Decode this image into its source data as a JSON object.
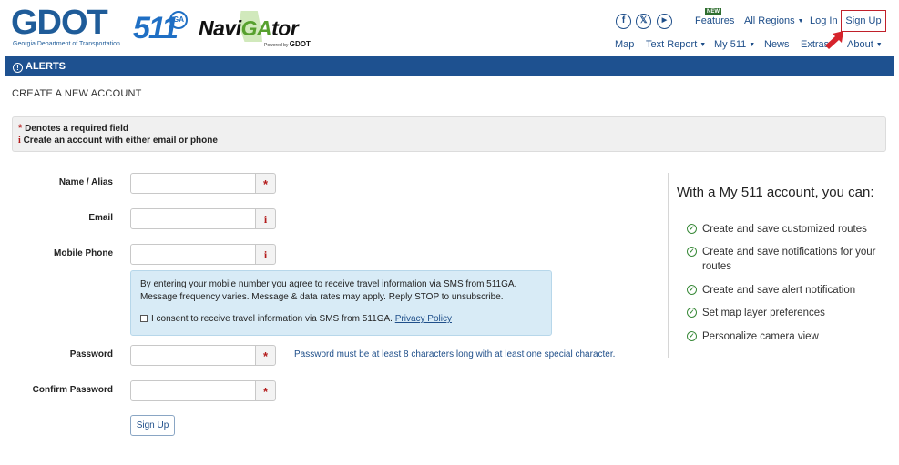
{
  "header": {
    "logo_gdot": "GDOT",
    "logo_gdot_sub": "Georgia Department of Transportation",
    "logo_511": "511",
    "logo_511_ga": "GA",
    "logo_navigator_pre": "Navi",
    "logo_navigator_ga": "GA",
    "logo_navigator_post": "tor",
    "logo_navigator_powered": "Powered by",
    "logo_navigator_gdot": "GDOT",
    "social": [
      "f",
      "𝕏",
      "▶"
    ],
    "new_badge": "NEW",
    "top_links": {
      "features": "Features",
      "regions": "All Regions",
      "login": "Log In",
      "signup": "Sign Up"
    },
    "nav": {
      "map": "Map",
      "text_report": "Text Report",
      "my511": "My 511",
      "news": "News",
      "extras": "Extras",
      "about": "About"
    }
  },
  "alerts_bar": {
    "icon": "!",
    "label": "ALERTS"
  },
  "page_title": "CREATE A NEW ACCOUNT",
  "notice": {
    "required_marker": "*",
    "required": "Denotes a required field",
    "info_marker": "i",
    "info": "Create an account with either email or phone"
  },
  "form": {
    "name_label": "Name / Alias",
    "email_label": "Email",
    "phone_label": "Mobile Phone",
    "password_label": "Password",
    "confirm_label": "Confirm Password",
    "required_marker": "*",
    "info_marker": "i",
    "sms_notice": "By entering your mobile number you agree to receive travel information via SMS from 511GA. Message frequency varies. Message & data rates may apply. Reply STOP to unsubscribe.",
    "sms_consent": "I consent to receive travel information via SMS from 511GA.",
    "privacy_link": "Privacy Policy",
    "password_hint": "Password must be at least 8 characters long with at least one special character.",
    "submit": "Sign Up"
  },
  "benefits": {
    "title": "With a My 511 account, you can:",
    "check_icon": "✓",
    "items": [
      "Create and save customized routes",
      "Create and save notifications for your routes",
      "Create and save alert notification",
      "Set map layer preferences",
      "Personalize camera view"
    ]
  }
}
